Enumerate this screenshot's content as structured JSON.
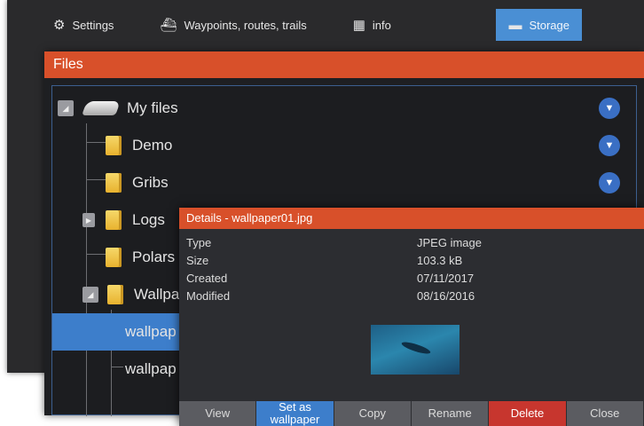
{
  "topbar": {
    "tabs": [
      {
        "label": "Settings",
        "icon": "gear-icon"
      },
      {
        "label": "Waypoints, routes, trails",
        "icon": "boat-icon"
      },
      {
        "label": "info",
        "icon": "info-icon"
      },
      {
        "label": "Storage",
        "icon": "folder-icon",
        "active": true
      }
    ]
  },
  "files": {
    "title": "Files",
    "tree": [
      {
        "label": "My files",
        "icon": "drive-icon",
        "expander": "collapse"
      },
      {
        "label": "Demo",
        "icon": "folder-icon"
      },
      {
        "label": "Gribs",
        "icon": "folder-icon"
      },
      {
        "label": "Logs",
        "icon": "folder-icon",
        "expander": "expand"
      },
      {
        "label": "Polars",
        "icon": "folder-icon"
      },
      {
        "label": "Wallpa",
        "icon": "folder-icon",
        "expander": "collapse"
      },
      {
        "label": "wallpap",
        "selected": true
      },
      {
        "label": "wallpap"
      }
    ]
  },
  "details": {
    "title": "Details - wallpaper01.jpg",
    "fields": [
      {
        "key": "Type",
        "value": "JPEG image"
      },
      {
        "key": "Size",
        "value": "103.3 kB"
      },
      {
        "key": "Created",
        "value": "07/11/2017"
      },
      {
        "key": "Modified",
        "value": "08/16/2016"
      }
    ],
    "buttons": {
      "view": "View",
      "set_wallpaper": "Set as wallpaper",
      "copy": "Copy",
      "rename": "Rename",
      "delete": "Delete",
      "close": "Close"
    }
  },
  "colors": {
    "title_bar": "#d8502a",
    "accent": "#3d7ecb",
    "danger": "#c7362e"
  }
}
